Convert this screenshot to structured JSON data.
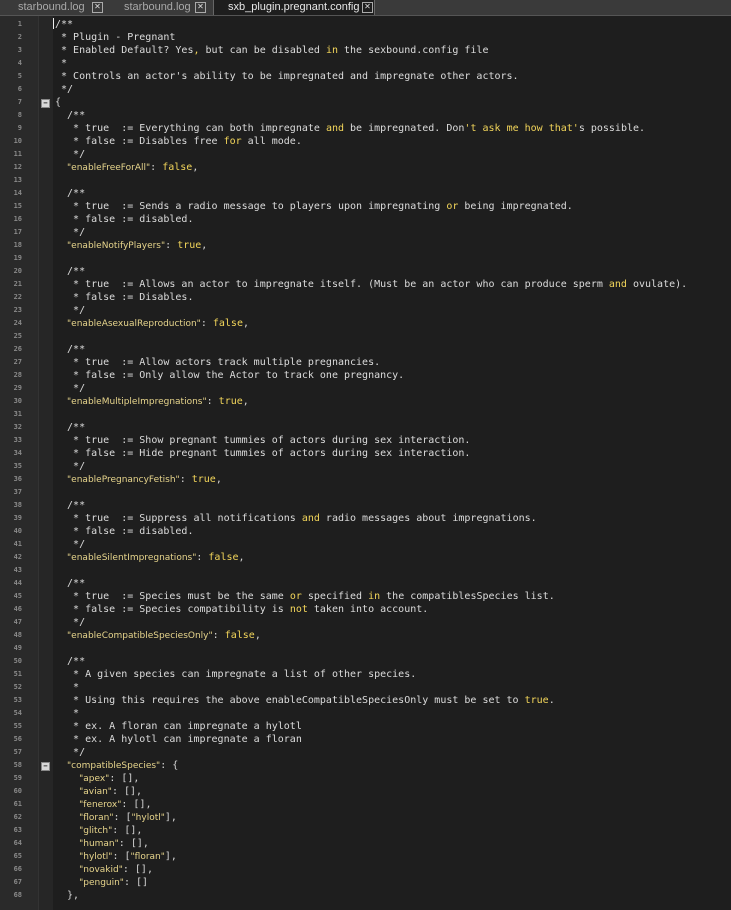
{
  "tabs": [
    {
      "label": "starbound.log",
      "active": false
    },
    {
      "label": "starbound.log",
      "active": false
    },
    {
      "label": "sxb_plugin.pregnant.config",
      "active": true
    }
  ],
  "close_glyph": "✕",
  "fold_glyph": "−",
  "lines": [
    [
      [
        "/**",
        "cmt"
      ]
    ],
    [
      [
        " * Plugin - Pregnant",
        "cmt"
      ]
    ],
    [
      [
        " * Enabled Default? Yes",
        "cmt"
      ],
      [
        ",",
        "kw"
      ],
      [
        " but can be disabled ",
        "cmt"
      ],
      [
        "in",
        "kw"
      ],
      [
        " the sexbound.config file",
        "cmt"
      ]
    ],
    [
      [
        " *",
        "cmt"
      ]
    ],
    [
      [
        " * Controls an actor's ability to be impregnated and impregnate other actors.",
        "cmt"
      ]
    ],
    [
      [
        " */",
        "cmt"
      ]
    ],
    [
      [
        "{",
        "punct"
      ]
    ],
    [
      [
        "  /**",
        "cmt"
      ]
    ],
    [
      [
        "   * true  := Everything can both impregnate ",
        "cmt"
      ],
      [
        "and",
        "kw"
      ],
      [
        " be impregnated. Don",
        "cmt"
      ],
      [
        "'t ask me how that'",
        "kw"
      ],
      [
        "s possible.",
        "cmt"
      ]
    ],
    [
      [
        "   * false := Disables free ",
        "cmt"
      ],
      [
        "for",
        "kw"
      ],
      [
        " all mode.",
        "cmt"
      ]
    ],
    [
      [
        "   */",
        "cmt"
      ]
    ],
    [
      [
        "  ",
        "punct"
      ],
      [
        "\"enableFreeForAll\"",
        "key"
      ],
      [
        ": ",
        "punct"
      ],
      [
        "false",
        "val"
      ],
      [
        ",",
        "punct"
      ]
    ],
    [
      [
        "",
        "punct"
      ]
    ],
    [
      [
        "  /**",
        "cmt"
      ]
    ],
    [
      [
        "   * true  := Sends a radio message to players upon impregnating ",
        "cmt"
      ],
      [
        "or",
        "kw"
      ],
      [
        " being impregnated.",
        "cmt"
      ]
    ],
    [
      [
        "   * false := disabled.",
        "cmt"
      ]
    ],
    [
      [
        "   */",
        "cmt"
      ]
    ],
    [
      [
        "  ",
        "punct"
      ],
      [
        "\"enableNotifyPlayers\"",
        "key"
      ],
      [
        ": ",
        "punct"
      ],
      [
        "true",
        "val"
      ],
      [
        ",",
        "punct"
      ]
    ],
    [
      [
        "",
        "punct"
      ]
    ],
    [
      [
        "  /**",
        "cmt"
      ]
    ],
    [
      [
        "   * true  := Allows an actor to impregnate itself. (Must be an actor who can produce sperm ",
        "cmt"
      ],
      [
        "and",
        "kw"
      ],
      [
        " ovulate).",
        "cmt"
      ]
    ],
    [
      [
        "   * false := Disables.",
        "cmt"
      ]
    ],
    [
      [
        "   */",
        "cmt"
      ]
    ],
    [
      [
        "  ",
        "punct"
      ],
      [
        "\"enableAsexualReproduction\"",
        "key"
      ],
      [
        ": ",
        "punct"
      ],
      [
        "false",
        "val"
      ],
      [
        ",",
        "punct"
      ]
    ],
    [
      [
        "",
        "punct"
      ]
    ],
    [
      [
        "  /**",
        "cmt"
      ]
    ],
    [
      [
        "   * true  := Allow actors track multiple pregnancies.",
        "cmt"
      ]
    ],
    [
      [
        "   * false := Only allow the Actor to track one pregnancy.",
        "cmt"
      ]
    ],
    [
      [
        "   */",
        "cmt"
      ]
    ],
    [
      [
        "  ",
        "punct"
      ],
      [
        "\"enableMultipleImpregnations\"",
        "key"
      ],
      [
        ": ",
        "punct"
      ],
      [
        "true",
        "val"
      ],
      [
        ",",
        "punct"
      ]
    ],
    [
      [
        "",
        "punct"
      ]
    ],
    [
      [
        "  /**",
        "cmt"
      ]
    ],
    [
      [
        "   * true  := Show pregnant tummies of actors during sex interaction.",
        "cmt"
      ]
    ],
    [
      [
        "   * false := Hide pregnant tummies of actors during sex interaction.",
        "cmt"
      ]
    ],
    [
      [
        "   */",
        "cmt"
      ]
    ],
    [
      [
        "  ",
        "punct"
      ],
      [
        "\"enablePregnancyFetish\"",
        "key"
      ],
      [
        ": ",
        "punct"
      ],
      [
        "true",
        "val"
      ],
      [
        ",",
        "punct"
      ]
    ],
    [
      [
        "",
        "punct"
      ]
    ],
    [
      [
        "  /**",
        "cmt"
      ]
    ],
    [
      [
        "   * true  := Suppress all notifications ",
        "cmt"
      ],
      [
        "and",
        "kw"
      ],
      [
        " radio messages about impregnations.",
        "cmt"
      ]
    ],
    [
      [
        "   * false := disabled.",
        "cmt"
      ]
    ],
    [
      [
        "   */",
        "cmt"
      ]
    ],
    [
      [
        "  ",
        "punct"
      ],
      [
        "\"enableSilentImpregnations\"",
        "key"
      ],
      [
        ": ",
        "punct"
      ],
      [
        "false",
        "val"
      ],
      [
        ",",
        "punct"
      ]
    ],
    [
      [
        "",
        "punct"
      ]
    ],
    [
      [
        "  /**",
        "cmt"
      ]
    ],
    [
      [
        "   * true  := Species must be the same ",
        "cmt"
      ],
      [
        "or",
        "kw"
      ],
      [
        " specified ",
        "cmt"
      ],
      [
        "in",
        "kw"
      ],
      [
        " the compatiblesSpecies list.",
        "cmt"
      ]
    ],
    [
      [
        "   * false := Species compatibility is ",
        "cmt"
      ],
      [
        "not",
        "kw"
      ],
      [
        " taken into account.",
        "cmt"
      ]
    ],
    [
      [
        "   */",
        "cmt"
      ]
    ],
    [
      [
        "  ",
        "punct"
      ],
      [
        "\"enableCompatibleSpeciesOnly\"",
        "key"
      ],
      [
        ": ",
        "punct"
      ],
      [
        "false",
        "val"
      ],
      [
        ",",
        "punct"
      ]
    ],
    [
      [
        "",
        "punct"
      ]
    ],
    [
      [
        "  /**",
        "cmt"
      ]
    ],
    [
      [
        "   * A given species can impregnate a list of other species.",
        "cmt"
      ]
    ],
    [
      [
        "   *",
        "cmt"
      ]
    ],
    [
      [
        "   * Using this requires the above enableCompatibleSpeciesOnly must be set to ",
        "cmt"
      ],
      [
        "true",
        "kw"
      ],
      [
        ".",
        "cmt"
      ]
    ],
    [
      [
        "   *",
        "cmt"
      ]
    ],
    [
      [
        "   * ex. A floran can impregnate a hylotl",
        "cmt"
      ]
    ],
    [
      [
        "   * ex. A hylotl can impregnate a floran",
        "cmt"
      ]
    ],
    [
      [
        "   */",
        "cmt"
      ]
    ],
    [
      [
        "  ",
        "punct"
      ],
      [
        "\"compatibleSpecies\"",
        "key"
      ],
      [
        ": {",
        "punct"
      ]
    ],
    [
      [
        "    ",
        "punct"
      ],
      [
        "\"apex\"",
        "key"
      ],
      [
        ": [],",
        "punct"
      ]
    ],
    [
      [
        "    ",
        "punct"
      ],
      [
        "\"avian\"",
        "key"
      ],
      [
        ": [],",
        "punct"
      ]
    ],
    [
      [
        "    ",
        "punct"
      ],
      [
        "\"fenerox\"",
        "key"
      ],
      [
        ": [],",
        "punct"
      ]
    ],
    [
      [
        "    ",
        "punct"
      ],
      [
        "\"floran\"",
        "key"
      ],
      [
        ": [",
        "punct"
      ],
      [
        "\"hylotl\"",
        "key"
      ],
      [
        "],",
        "punct"
      ]
    ],
    [
      [
        "    ",
        "punct"
      ],
      [
        "\"glitch\"",
        "key"
      ],
      [
        ": [],",
        "punct"
      ]
    ],
    [
      [
        "    ",
        "punct"
      ],
      [
        "\"human\"",
        "key"
      ],
      [
        ": [],",
        "punct"
      ]
    ],
    [
      [
        "    ",
        "punct"
      ],
      [
        "\"hylotl\"",
        "key"
      ],
      [
        ": [",
        "punct"
      ],
      [
        "\"floran\"",
        "key"
      ],
      [
        "],",
        "punct"
      ]
    ],
    [
      [
        "    ",
        "punct"
      ],
      [
        "\"novakid\"",
        "key"
      ],
      [
        ": [],",
        "punct"
      ]
    ],
    [
      [
        "    ",
        "punct"
      ],
      [
        "\"penguin\"",
        "key"
      ],
      [
        ": []",
        "punct"
      ]
    ],
    [
      [
        "  },",
        "punct"
      ]
    ]
  ],
  "fold_lines": [
    7,
    58
  ]
}
